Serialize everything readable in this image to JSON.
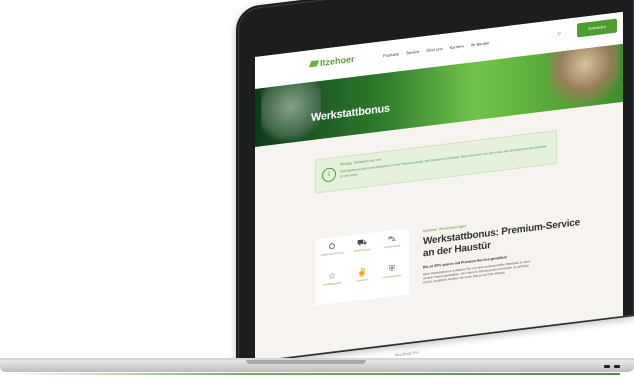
{
  "site": {
    "logo": "Itzehoer",
    "nav": [
      "Produkte",
      "Service",
      "Über uns",
      "Karriere",
      "Ihr Berater"
    ],
    "cta": "Anmelden"
  },
  "hero": {
    "title": "Werkstattbonus"
  },
  "notice": {
    "title": "Wichtig: Teilnahme nur mit",
    "text": "Werkstattbonus gilt nur bei Reparatur in einer Partnerwerkstatt. Die Teilnahme ist freiwillig. Bitte informieren Sie sich vorab über die teilnehmenden Betriebe in Ihrer Nähe."
  },
  "services": [
    {
      "icon": "car-wrench-icon",
      "label": "Kostenlose Abholung"
    },
    {
      "icon": "truck-icon",
      "label": "Ersatzfahrzeug"
    },
    {
      "icon": "car-front-icon",
      "label": "Innenreinigung"
    },
    {
      "icon": "star-icon",
      "label": "Qualitätsgarantie"
    },
    {
      "icon": "thumbs-up-icon",
      "label": "Sparvorteil"
    },
    {
      "icon": "shield-check-icon",
      "label": "Geprüfte Betriebe"
    }
  ],
  "content": {
    "kicker": "Itzehoer Versicherungen",
    "headline": "Werkstattbonus: Premium-Service an der Haustür",
    "subhead": "Bis zu 20% sparen mit Premium-Service genießen!",
    "body": "Beim Werkstattbonus profitieren Sie von einer professionellen Reparatur in einer unserer Partnerwerkstätten. Wir holen Ihr Fahrzeug ab und bringen es gereinigt zurück. Zusätzlich erhalten Sie einen Bonus auf Ihren Beitrag."
  },
  "device": {
    "label": "MacBook Pro"
  },
  "colors": {
    "accent": "#4e9e2d",
    "brand": "#5e9e36"
  }
}
